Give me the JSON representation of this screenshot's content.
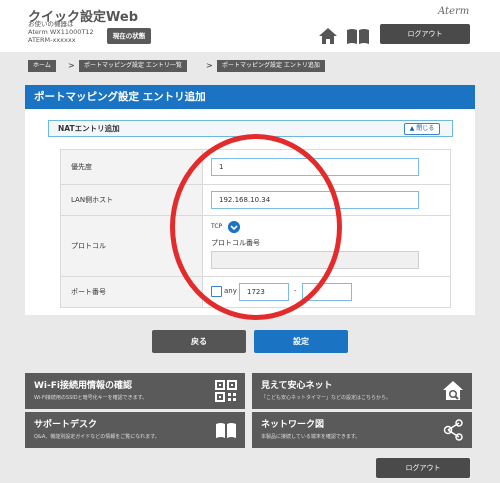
{
  "header": {
    "app_title": "クイック設定Web",
    "device_label": "お使いの機器は",
    "device_model": "Aterm WX11000T12",
    "device_serial": "ATERM-xxxxxx",
    "status_button": "現在の状態",
    "brand": "Aterm",
    "logout": "ログアウト"
  },
  "breadcrumb": [
    "ホーム",
    "ポートマッピング設定 エントリ一覧",
    "ポートマッピング設定 エントリ追加"
  ],
  "page_title": "ポートマッピング設定 エントリ追加",
  "section": {
    "title": "NATエントリ追加",
    "close_label": "閉じる"
  },
  "form": {
    "priority_label": "優先度",
    "priority_value": "1",
    "lan_host_label": "LAN側ホスト",
    "lan_host_value": "192.168.10.34",
    "protocol_label": "プロトコル",
    "protocol_value": "TCP",
    "protocol_number_label": "プロトコル番号",
    "protocol_number_value": "",
    "port_label": "ポート番号",
    "any_label": "any",
    "port_from": "1723",
    "port_separator": "-",
    "port_to": ""
  },
  "buttons": {
    "back": "戻る",
    "apply": "設定"
  },
  "tiles": [
    {
      "title": "Wi-Fi接続用情報の確認",
      "desc": "Wi-Fi接続用のSSIDと暗号化キーを確認できます。"
    },
    {
      "title": "見えて安心ネット",
      "desc": "「こども安心ネットタイマー」などの設定はこちらから。"
    },
    {
      "title": "サポートデスク",
      "desc": "Q&A、機能別設定ガイドなどの情報をご覧になれます。"
    },
    {
      "title": "ネットワーク図",
      "desc": "本製品に接続している端末を確認できます。"
    }
  ],
  "footer": {
    "logout": "ログアウト"
  },
  "colors": {
    "accent_blue": "#1b73c4",
    "button_gray": "#555555",
    "highlight_circle": "#e32b2b"
  }
}
